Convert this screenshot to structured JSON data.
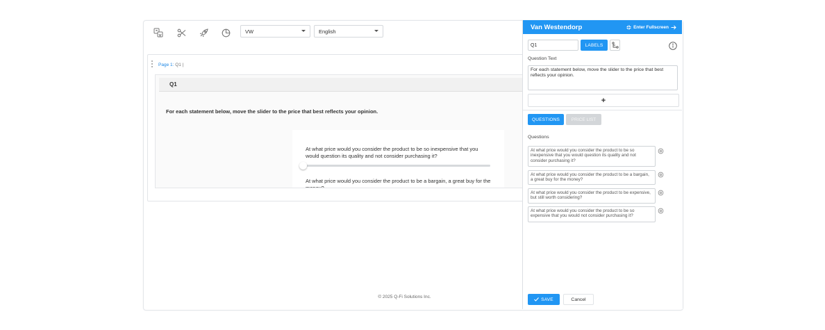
{
  "toolbar": {
    "icons": [
      "translate-icon",
      "scissors-icon",
      "rocket-icon",
      "pie-chart-icon"
    ],
    "survey_select": "VW",
    "language_select": "English"
  },
  "editor": {
    "page_label": "Page 1:",
    "page_questions": "Q1 |",
    "question": {
      "name": "Q1",
      "text": "For each statement below, move the slider to the price that best reflects your opinion.",
      "sliders": [
        "At what price would you consider the product to be so inexpensive that you would question its quality and not consider purchasing it?",
        "At what price would you consider the product to be a bargain, a great buy for the money?"
      ]
    }
  },
  "footer": {
    "copyright": "© 2025 Q-Fi Solutions Inc."
  },
  "panel": {
    "title": "Van Westendorp",
    "fullscreen_label": "Enter Fullscreen",
    "question_name": "Q1",
    "labels_button": "LABELS",
    "question_text_label": "Question Text",
    "question_text": "For each statement below, move the slider to the price that best reflects your opinion.",
    "add_symbol": "+",
    "tab_questions": "QUESTIONS",
    "tab_price_list": "PRICE LIST",
    "questions_label": "Questions",
    "questions": [
      "At what price would you consider the product to be so inexpensive that you would question its quality and not consider purchasing it?",
      "At what price would you consider the product to be a bargain, a great buy for the money?",
      "At what price would you consider the product to be expensive, but still worth considering?",
      "At what price would you consider the product to be so expensive that you would not consider purchasing it?"
    ],
    "save_label": "SAVE",
    "cancel_label": "Cancel"
  },
  "colors": {
    "accent": "#2196f3",
    "disabled": "#d3d6d9"
  }
}
